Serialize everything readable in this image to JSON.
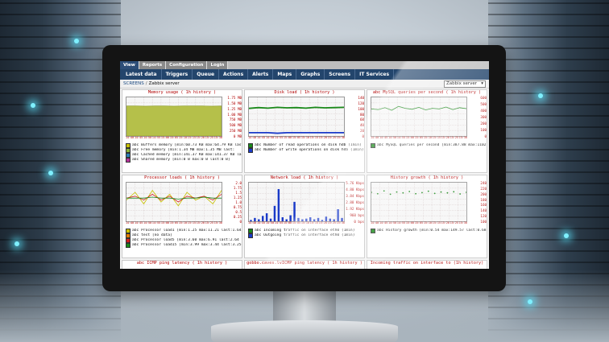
{
  "colors": {
    "accent": "#23456c",
    "title_red": "#b00000",
    "grid_bg": "#f6f6f6"
  },
  "topnav": {
    "tabs": [
      "View",
      "Reports",
      "Configuration",
      "Login"
    ],
    "active": 0
  },
  "menubar": {
    "items": [
      "Latest data",
      "Triggers",
      "Queue",
      "Actions",
      "Alerts",
      "Maps",
      "Graphs",
      "Screens",
      "IT Services"
    ]
  },
  "breadcrumb": {
    "section": "SCREENS",
    "current": "Zabbix server"
  },
  "server_select": {
    "value": "Zabbix server",
    "icon": "chevron-down-icon"
  },
  "panels": [
    {
      "title": "Memory usage ( 1h history )",
      "yticks": [
        "1.75 MB",
        "1.50 MB",
        "1.25 MB",
        "1.00 MB",
        "750 MB",
        "500 MB",
        "250 MB",
        "0 MB"
      ],
      "xticks": [
        "14:40",
        "14:45",
        "14:50",
        "14:55",
        "15:00",
        "15:05",
        "15:10",
        "15:15",
        "15:20",
        "15:25",
        "15:30"
      ],
      "legend": [
        {
          "text": "abc Buffers memory [min:60.73 KB max:64.79 KB last:",
          "color": "#c8c000"
        },
        {
          "text": "abc Free memory   [min:1.34 MB max:1.35 MB last:",
          "color": "#8ab33a"
        },
        {
          "text": "abc Cached memory [min:141.37 KB max:141.37 KB last:",
          "color": "#2a7fb5"
        },
        {
          "text": "abc Shared memory [min:0 B max:0 B last:0 B]",
          "color": "#b5329a"
        }
      ]
    },
    {
      "title": "Disk load ( 1h history )",
      "yticks": [
        "140",
        "120",
        "100",
        "80",
        "60",
        "40",
        "20",
        "0"
      ],
      "xticks": [
        "14:40",
        "14:45",
        "14:50",
        "14:55",
        "15:00",
        "15:05",
        "15:10",
        "15:15",
        "15:20",
        "15:25",
        "15:30"
      ],
      "legend": [
        {
          "text": "abc Number of read operations on disk hdb (1min)",
          "color": "#1a8a1a"
        },
        {
          "text": "abc Number of write operations on disk hdb (1min)",
          "color": "#1a3ac8"
        }
      ]
    },
    {
      "title": "abc MySQL queries per second ( 1h history )",
      "yticks": [
        "600",
        "500",
        "400",
        "300",
        "200",
        "100",
        "0"
      ],
      "xticks": [
        "14:40",
        "14:45",
        "14:50",
        "14:55",
        "15:00",
        "15:05",
        "15:10",
        "15:15",
        "15:20",
        "15:25",
        "15:30"
      ],
      "legend": [
        {
          "text": "abc MySQL queries per second [min:387.88 max:1102.4",
          "color": "#1a8a1a"
        }
      ]
    },
    {
      "title": "Processor loads ( 1h history )",
      "yticks": [
        "2.0",
        "1.75",
        "1.5",
        "1.25",
        "1.0",
        "0.75",
        "0.5",
        "0.25",
        "0"
      ],
      "xticks": [
        "14:40",
        "14:45",
        "14:50",
        "14:55",
        "15:00",
        "15:05",
        "15:10",
        "15:15",
        "15:20",
        "15:25",
        "15:30"
      ],
      "legend": [
        {
          "text": "abc Processor load1  [min:1.25 max:11.21 last:1.64",
          "color": "#c8c000"
        },
        {
          "text": "abc test           [no data]",
          "color": "#e07b00"
        },
        {
          "text": "abc Processor load5  [min:3.60 max:6.91 last:2.64",
          "color": "#d02020"
        },
        {
          "text": "abc Processor load15 [min:3.99 max:3.44 last:3.25",
          "color": "#1a8a1a"
        }
      ]
    },
    {
      "title": "Network load ( 1h history )",
      "yticks": [
        "5.76 Kbps",
        "4.80 Kbps",
        "3.84 Kbps",
        "2.88 Kbps",
        "1.92 Kbps",
        "960 bps",
        "0 bps"
      ],
      "xticks": [
        "14:40",
        "14:45",
        "14:50",
        "14:55",
        "15:00",
        "15:05",
        "15:10",
        "15:15",
        "15:20",
        "15:25",
        "15:30"
      ],
      "legend": [
        {
          "text": "abc Incoming traffic on interface eth0 (1min)",
          "color": "#1a8a1a"
        },
        {
          "text": "abc Outgoing traffic on interface eth0 (1min)",
          "color": "#1a3ac8"
        }
      ]
    },
    {
      "title": "History growth ( 1h history )",
      "yticks": [
        "240",
        "220",
        "200",
        "180",
        "160",
        "140",
        "120",
        "100"
      ],
      "xticks": [
        "14:40",
        "14:45",
        "14:50",
        "14:55",
        "15:00",
        "15:05",
        "15:10",
        "15:15",
        "15:20",
        "15:25",
        "15:30"
      ],
      "legend": [
        {
          "text": "abc History growth [min:0.54 max:149.57 last:0.68",
          "color": "#1a8a1a"
        }
      ]
    }
  ],
  "bottom_panels": [
    "abc ICMP ping latency ( 1h history )",
    "gobbo.caves.lvICMP ping latency ( 1h history )",
    "Incoming traffic on interface to (1h history)"
  ],
  "chart_data": [
    {
      "type": "area",
      "title": "Memory usage ( 1h history )",
      "series": [
        {
          "name": "Free memory",
          "values": [
            1.36,
            1.36,
            1.35,
            1.36,
            1.36,
            1.35,
            1.36,
            1.36,
            1.36,
            1.35,
            1.36
          ]
        }
      ],
      "ylim": [
        0,
        1.75
      ]
    },
    {
      "type": "line",
      "title": "Disk load ( 1h history )",
      "series": [
        {
          "name": "Number of read operations on disk hdb (1min)",
          "values": [
            100,
            103,
            101,
            104,
            102,
            103,
            101,
            104,
            102,
            103,
            104
          ]
        },
        {
          "name": "Number of write operations on disk hdb (1min)",
          "values": [
            12,
            12,
            12,
            10,
            12,
            12,
            12,
            12,
            12,
            12,
            12
          ]
        }
      ],
      "ylim": [
        0,
        140
      ]
    },
    {
      "type": "line",
      "title": "abc MySQL queries per second ( 1h history )",
      "series": [
        {
          "name": "MySQL queries per second",
          "values": [
            420,
            410,
            440,
            400,
            460,
            430,
            415,
            445,
            405,
            430,
            420,
            450,
            410,
            440,
            425
          ]
        }
      ],
      "ylim": [
        0,
        600
      ]
    },
    {
      "type": "line",
      "title": "Processor loads ( 1h history )",
      "series": [
        {
          "name": "Processor load1",
          "values": [
            1.1,
            1.5,
            0.9,
            1.6,
            1.0,
            1.4,
            0.8,
            1.5,
            1.1,
            1.3,
            0.9,
            1.6
          ]
        },
        {
          "name": "Processor load5",
          "values": [
            1.2,
            1.3,
            1.1,
            1.4,
            1.1,
            1.3,
            1.0,
            1.3,
            1.2,
            1.3,
            1.1,
            1.4
          ]
        },
        {
          "name": "Processor load15",
          "values": [
            1.2,
            1.2,
            1.2,
            1.25,
            1.2,
            1.2,
            1.15,
            1.2,
            1.2,
            1.25,
            1.2,
            1.2
          ]
        }
      ],
      "ylim": [
        0,
        2.0
      ]
    },
    {
      "type": "bar",
      "title": "Network load ( 1h history )",
      "series": [
        {
          "name": "Incoming traffic on interface eth0 (1min)",
          "values": [
            0.2,
            0.5,
            0.3,
            0.8,
            1.2,
            0.4,
            2.3,
            4.8,
            0.6,
            0.3,
            0.9,
            2.9,
            0.5,
            0.3,
            0.4,
            0.6,
            0.3,
            0.5,
            0.2,
            0.7,
            0.4,
            0.3,
            1.8,
            0.5
          ]
        }
      ],
      "ylim": [
        0,
        5.76
      ]
    },
    {
      "type": "scatter",
      "title": "History growth ( 1h history )",
      "series": [
        {
          "name": "History growth",
          "values": [
            205,
            200,
            210,
            198,
            206,
            203,
            208,
            200,
            204,
            209,
            201,
            206,
            203,
            207,
            199,
            205
          ]
        }
      ],
      "ylim": [
        100,
        240
      ]
    }
  ]
}
